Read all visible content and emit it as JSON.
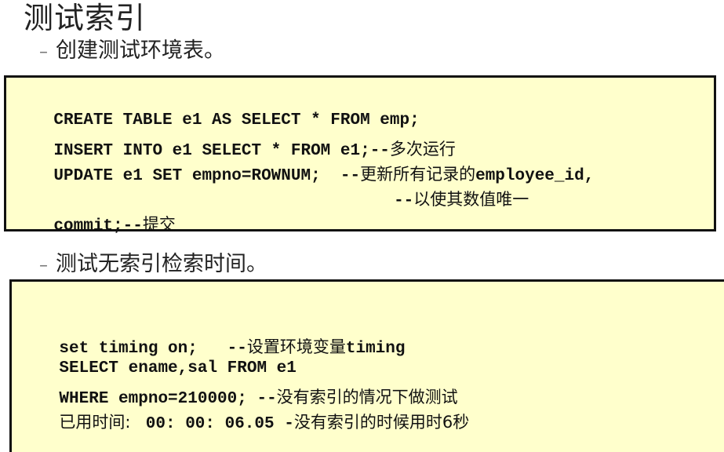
{
  "title": "测试索引",
  "section1": {
    "bullet": "创建测试环境表。",
    "code_lines": [
      {
        "code": "CREATE TABLE e1 AS SELECT * FROM emp;",
        "comment": ""
      },
      {
        "code": "INSERT INTO e1 SELECT * FROM e1;--",
        "comment": "多次运行"
      },
      {
        "code": "UPDATE e1 SET empno=ROWNUM;  --",
        "comment": "更新所有记录的",
        "code_tail": "employee_id,"
      },
      {
        "code": "                          --",
        "comment": "以使其数值唯一"
      },
      {
        "code": "commit;--",
        "comment": "提交"
      }
    ]
  },
  "section2": {
    "bullet": "测试无索引检索时间。",
    "code_lines": [
      {
        "code": "set timing on;   --",
        "comment": "设置环境变量",
        "code_tail": "timing"
      },
      {
        "code": "SELECT ename,sal FROM e1",
        "comment": ""
      },
      {
        "code": "WHERE empno=210000; --",
        "comment": "没有索引的情况下做测试"
      },
      {
        "prefix": "已用时间: ",
        "code": " 00: 00: 06.05 -",
        "comment": "没有索引的时候用时6秒"
      }
    ]
  },
  "dash": "–"
}
